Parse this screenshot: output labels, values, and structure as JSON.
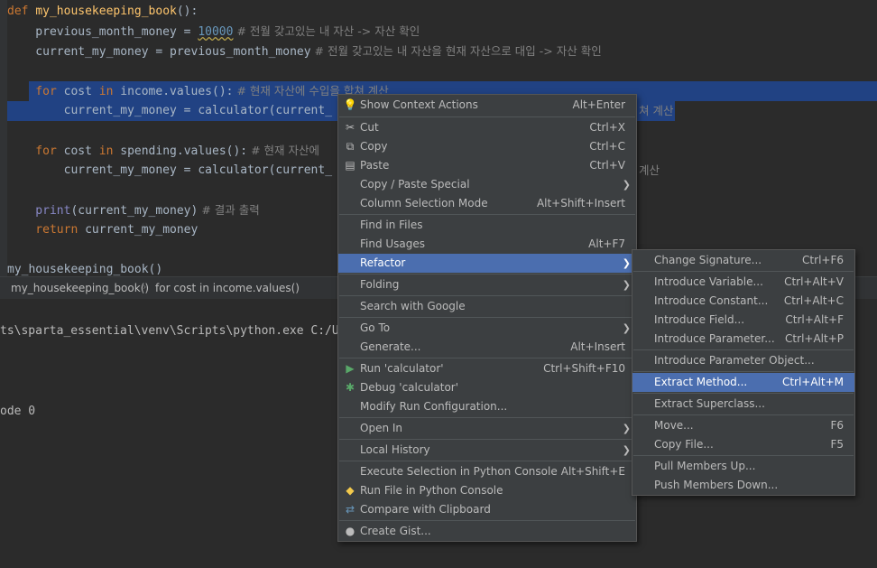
{
  "code": {
    "line1": {
      "kw": "def",
      "fn": "my_housekeeping_book",
      "rest": "():"
    },
    "line2": {
      "a": "    previous_month_money = ",
      "num": "10000",
      "cm": " # 전월 갖고있는 내 자산 -> 자산 확인"
    },
    "line3": {
      "a": "    current_my_money = previous_month_money",
      "cm": " # 전월 갖고있는 내 자산을 현재 자산으로 대입 -> 자산 확인"
    },
    "line5": {
      "kw1": "    for",
      "a": " cost ",
      "kw2": "in",
      "b": " income.values():",
      "cm": " # 현재 자산에 수입을 합쳐 계산"
    },
    "line6": {
      "a": "        current_my_money = calculator(current_",
      "cm_tail": "쳐 계산"
    },
    "line8": {
      "kw1": "    for",
      "a": " cost ",
      "kw2": "in",
      "b": " spending.values():",
      "cm": " # 현재 자산에"
    },
    "line9": {
      "a": "        current_my_money = calculator(current_",
      "cm_tail": "계산"
    },
    "line11": {
      "bi": "    print",
      "a": "(current_my_money)",
      "cm": " # 결과 출력"
    },
    "line12": {
      "kw": "    return",
      "a": " current_my_money"
    },
    "line14": {
      "a": "my_housekeeping_book()"
    }
  },
  "breadcrumb": {
    "item1": "my_housekeeping_book()",
    "sep": "›",
    "item2": "for cost in income.values()"
  },
  "console": {
    "line1": "ts\\sparta_essential\\venv\\Scripts\\python.exe C:/U",
    "line2": "ode 0"
  },
  "context_menu": {
    "show_context_actions": {
      "label": "Show Context Actions",
      "shortcut": "Alt+Enter",
      "icon": "lightbulb-icon"
    },
    "cut": {
      "label": "Cut",
      "shortcut": "Ctrl+X",
      "icon": "scissors-icon"
    },
    "copy": {
      "label": "Copy",
      "shortcut": "Ctrl+C",
      "icon": "copy-icon"
    },
    "paste": {
      "label": "Paste",
      "shortcut": "Ctrl+V",
      "icon": "clipboard-icon"
    },
    "copy_paste_special": {
      "label": "Copy / Paste Special"
    },
    "column_selection_mode": {
      "label": "Column Selection Mode",
      "shortcut": "Alt+Shift+Insert"
    },
    "find_in_files": {
      "label": "Find in Files"
    },
    "find_usages": {
      "label": "Find Usages",
      "shortcut": "Alt+F7"
    },
    "refactor": {
      "label": "Refactor"
    },
    "folding": {
      "label": "Folding"
    },
    "search_with_google": {
      "label": "Search with Google"
    },
    "go_to": {
      "label": "Go To"
    },
    "generate": {
      "label": "Generate...",
      "shortcut": "Alt+Insert"
    },
    "run": {
      "label": "Run 'calculator'",
      "shortcut": "Ctrl+Shift+F10",
      "icon": "run-icon"
    },
    "debug": {
      "label": "Debug 'calculator'",
      "icon": "bug-icon"
    },
    "modify_run_config": {
      "label": "Modify Run Configuration..."
    },
    "open_in": {
      "label": "Open In"
    },
    "local_history": {
      "label": "Local History"
    },
    "execute_selection": {
      "label": "Execute Selection in Python Console",
      "shortcut": "Alt+Shift+E"
    },
    "run_file_console": {
      "label": "Run File in Python Console",
      "icon": "python-icon"
    },
    "compare_clipboard": {
      "label": "Compare with Clipboard",
      "icon": "compare-icon"
    },
    "create_gist": {
      "label": "Create Gist...",
      "icon": "github-icon"
    }
  },
  "refactor_menu": {
    "change_signature": {
      "label": "Change Signature...",
      "shortcut": "Ctrl+F6"
    },
    "introduce_variable": {
      "label": "Introduce Variable...",
      "shortcut": "Ctrl+Alt+V"
    },
    "introduce_constant": {
      "label": "Introduce Constant...",
      "shortcut": "Ctrl+Alt+C"
    },
    "introduce_field": {
      "label": "Introduce Field...",
      "shortcut": "Ctrl+Alt+F"
    },
    "introduce_parameter": {
      "label": "Introduce Parameter...",
      "shortcut": "Ctrl+Alt+P"
    },
    "introduce_parameter_object": {
      "label": "Introduce Parameter Object..."
    },
    "extract_method": {
      "label": "Extract Method...",
      "shortcut": "Ctrl+Alt+M"
    },
    "extract_superclass": {
      "label": "Extract Superclass..."
    },
    "move": {
      "label": "Move...",
      "shortcut": "F6"
    },
    "copy_file": {
      "label": "Copy File...",
      "shortcut": "F5"
    },
    "pull_members_up": {
      "label": "Pull Members Up..."
    },
    "push_members_down": {
      "label": "Push Members Down..."
    }
  }
}
